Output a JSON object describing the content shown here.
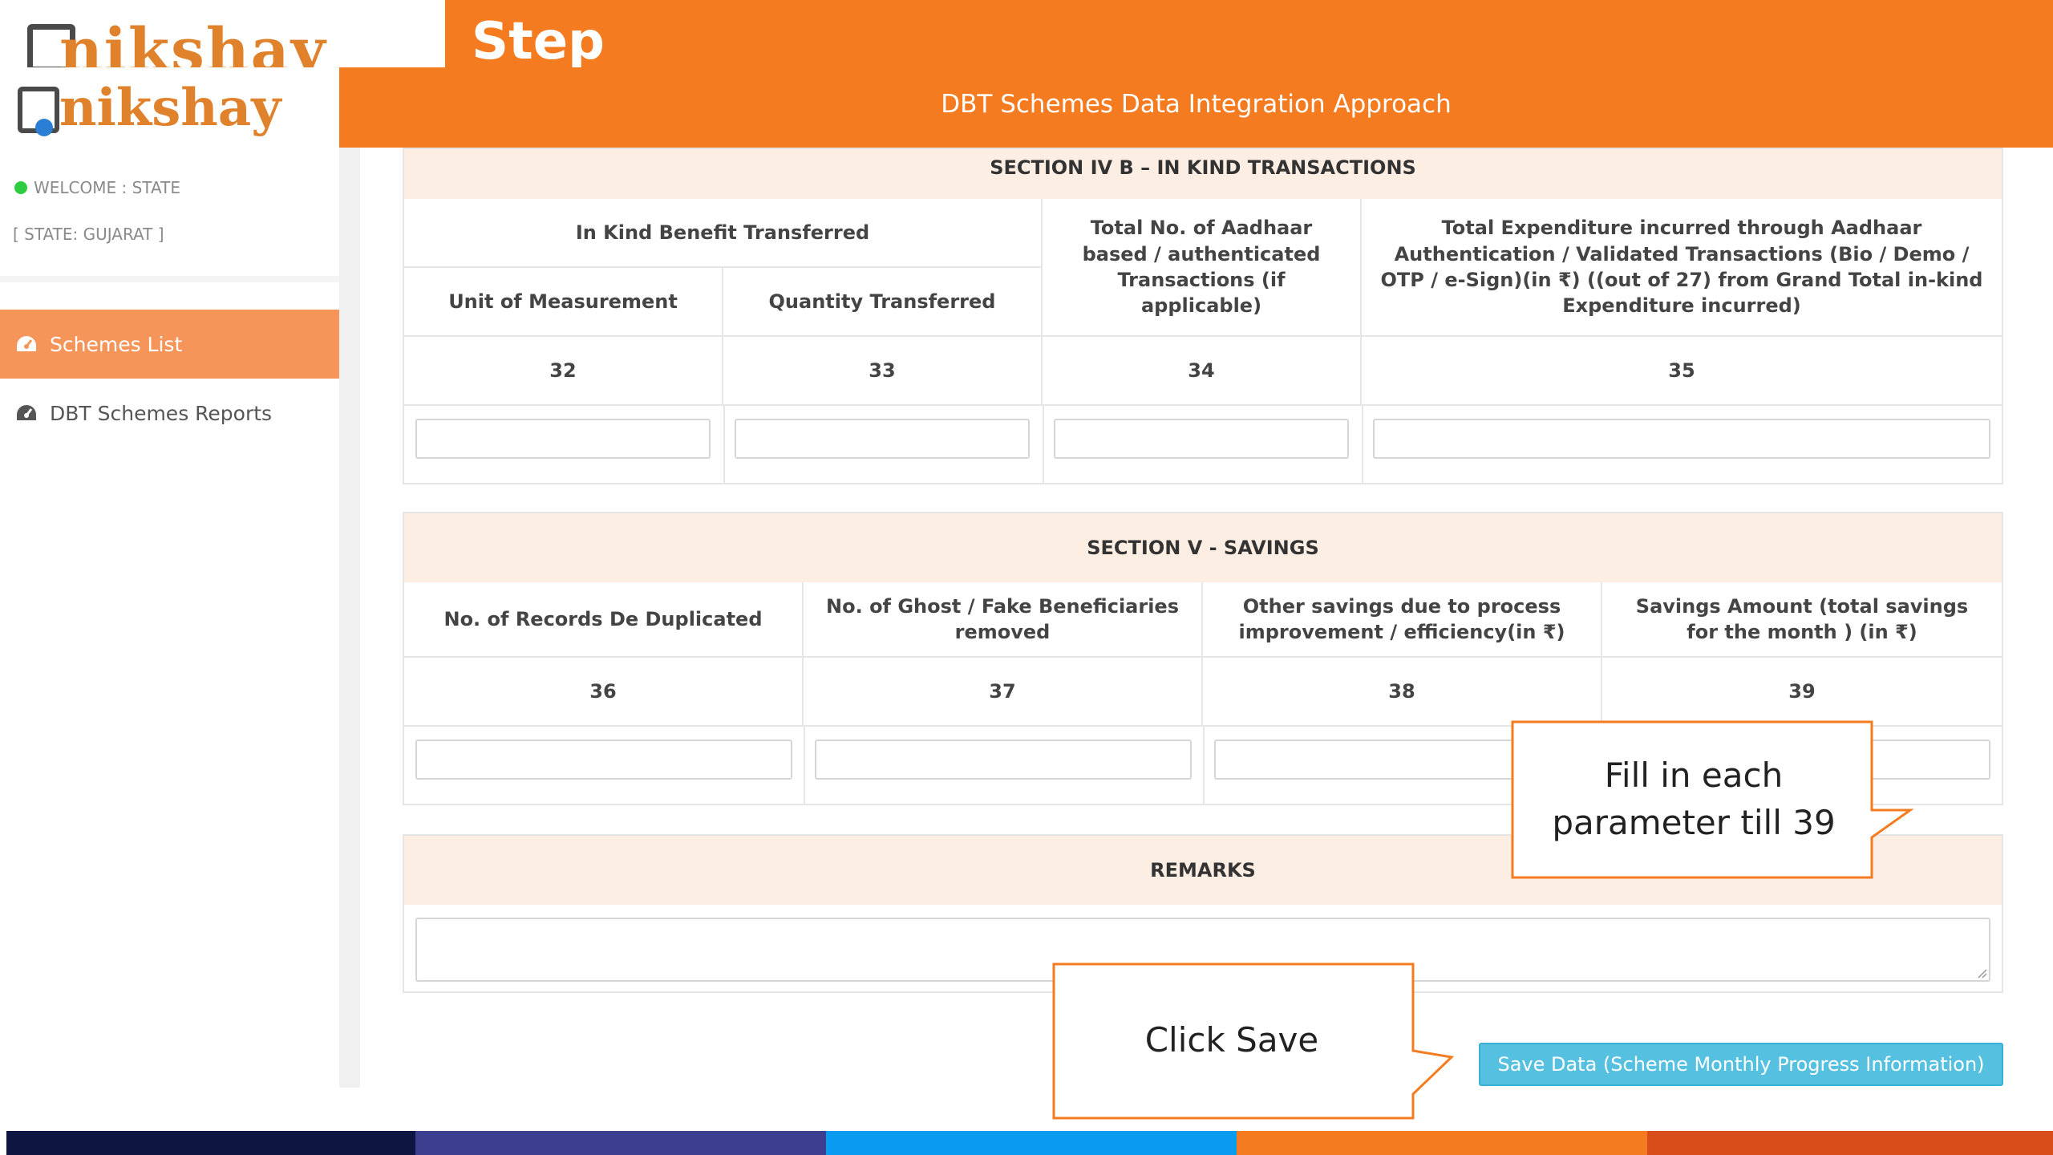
{
  "slide": {
    "step_title": "Step"
  },
  "header": {
    "title": "DBT Schemes Data Integration Approach"
  },
  "logo": {
    "text": "nikshay"
  },
  "sidebar": {
    "welcome": "WELCOME : STATE",
    "state": "[ STATE: GUJARAT ]",
    "items": [
      {
        "label": "Schemes List",
        "icon": "dashboard-icon",
        "active": true
      },
      {
        "label": "DBT Schemes Reports",
        "icon": "dashboard-icon",
        "active": false
      }
    ]
  },
  "section4b": {
    "title": "SECTION IV B – IN KIND TRANSACTIONS",
    "group_header": "In Kind Benefit Transferred",
    "columns": [
      {
        "label": "Unit of Measurement",
        "num": "32"
      },
      {
        "label": "Quantity Transferred",
        "num": "33"
      },
      {
        "label": "Total No. of Aadhaar based / authenticated Transactions (if applicable)",
        "num": "34"
      },
      {
        "label": "Total Expenditure incurred through Aadhaar Authentication / Validated Transactions (Bio / Demo / OTP / e-Sign)(in ₹) ((out of 27) from Grand Total in-kind Expenditure incurred)",
        "num": "35"
      }
    ]
  },
  "section5": {
    "title": "SECTION V - SAVINGS",
    "columns": [
      {
        "label": "No. of Records De Duplicated",
        "num": "36"
      },
      {
        "label": "No. of Ghost / Fake Beneficiaries removed",
        "num": "37"
      },
      {
        "label": "Other savings due to process improvement / efficiency(in ₹)",
        "num": "38"
      },
      {
        "label": "Savings Amount (total savings for the month ) (in ₹)",
        "num": "39"
      }
    ]
  },
  "remarks": {
    "title": "REMARKS"
  },
  "save": {
    "label": "Save Data (Scheme Monthly Progress Information)"
  },
  "callouts": {
    "fill": "Fill in each parameter till 39",
    "save": "Click Save"
  },
  "colors": {
    "accent": "#f47b20",
    "active_nav": "#f6955a",
    "section_head": "#fdeee3",
    "save_button": "#55c0e0"
  },
  "footer_strip": [
    "#0d1540",
    "#3c3f8f",
    "#0a9af0",
    "#f47b20",
    "#d84d1a"
  ]
}
